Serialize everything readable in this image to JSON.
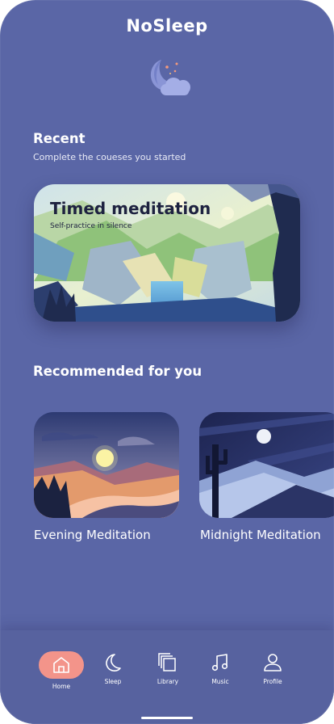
{
  "app": {
    "title": "NoSleep"
  },
  "recent": {
    "title": "Recent",
    "subtitle": "Complete the coueses you started",
    "card": {
      "title": "Timed meditation",
      "subtitle": "Self-practice in silence"
    }
  },
  "recommended": {
    "title": "Recommended for you",
    "items": [
      {
        "label": "Evening Meditation"
      },
      {
        "label": "Midnight Meditation"
      }
    ]
  },
  "tabbar": {
    "items": [
      {
        "label": "Home",
        "icon": "home-icon",
        "active": true
      },
      {
        "label": "Sleep",
        "icon": "moon-icon",
        "active": false
      },
      {
        "label": "Library",
        "icon": "library-icon",
        "active": false
      },
      {
        "label": "Music",
        "icon": "music-icon",
        "active": false
      },
      {
        "label": "Profile",
        "icon": "profile-icon",
        "active": false
      }
    ]
  },
  "colors": {
    "background": "#5a66a6",
    "accent": "#f3948a",
    "text": "#ffffff"
  }
}
